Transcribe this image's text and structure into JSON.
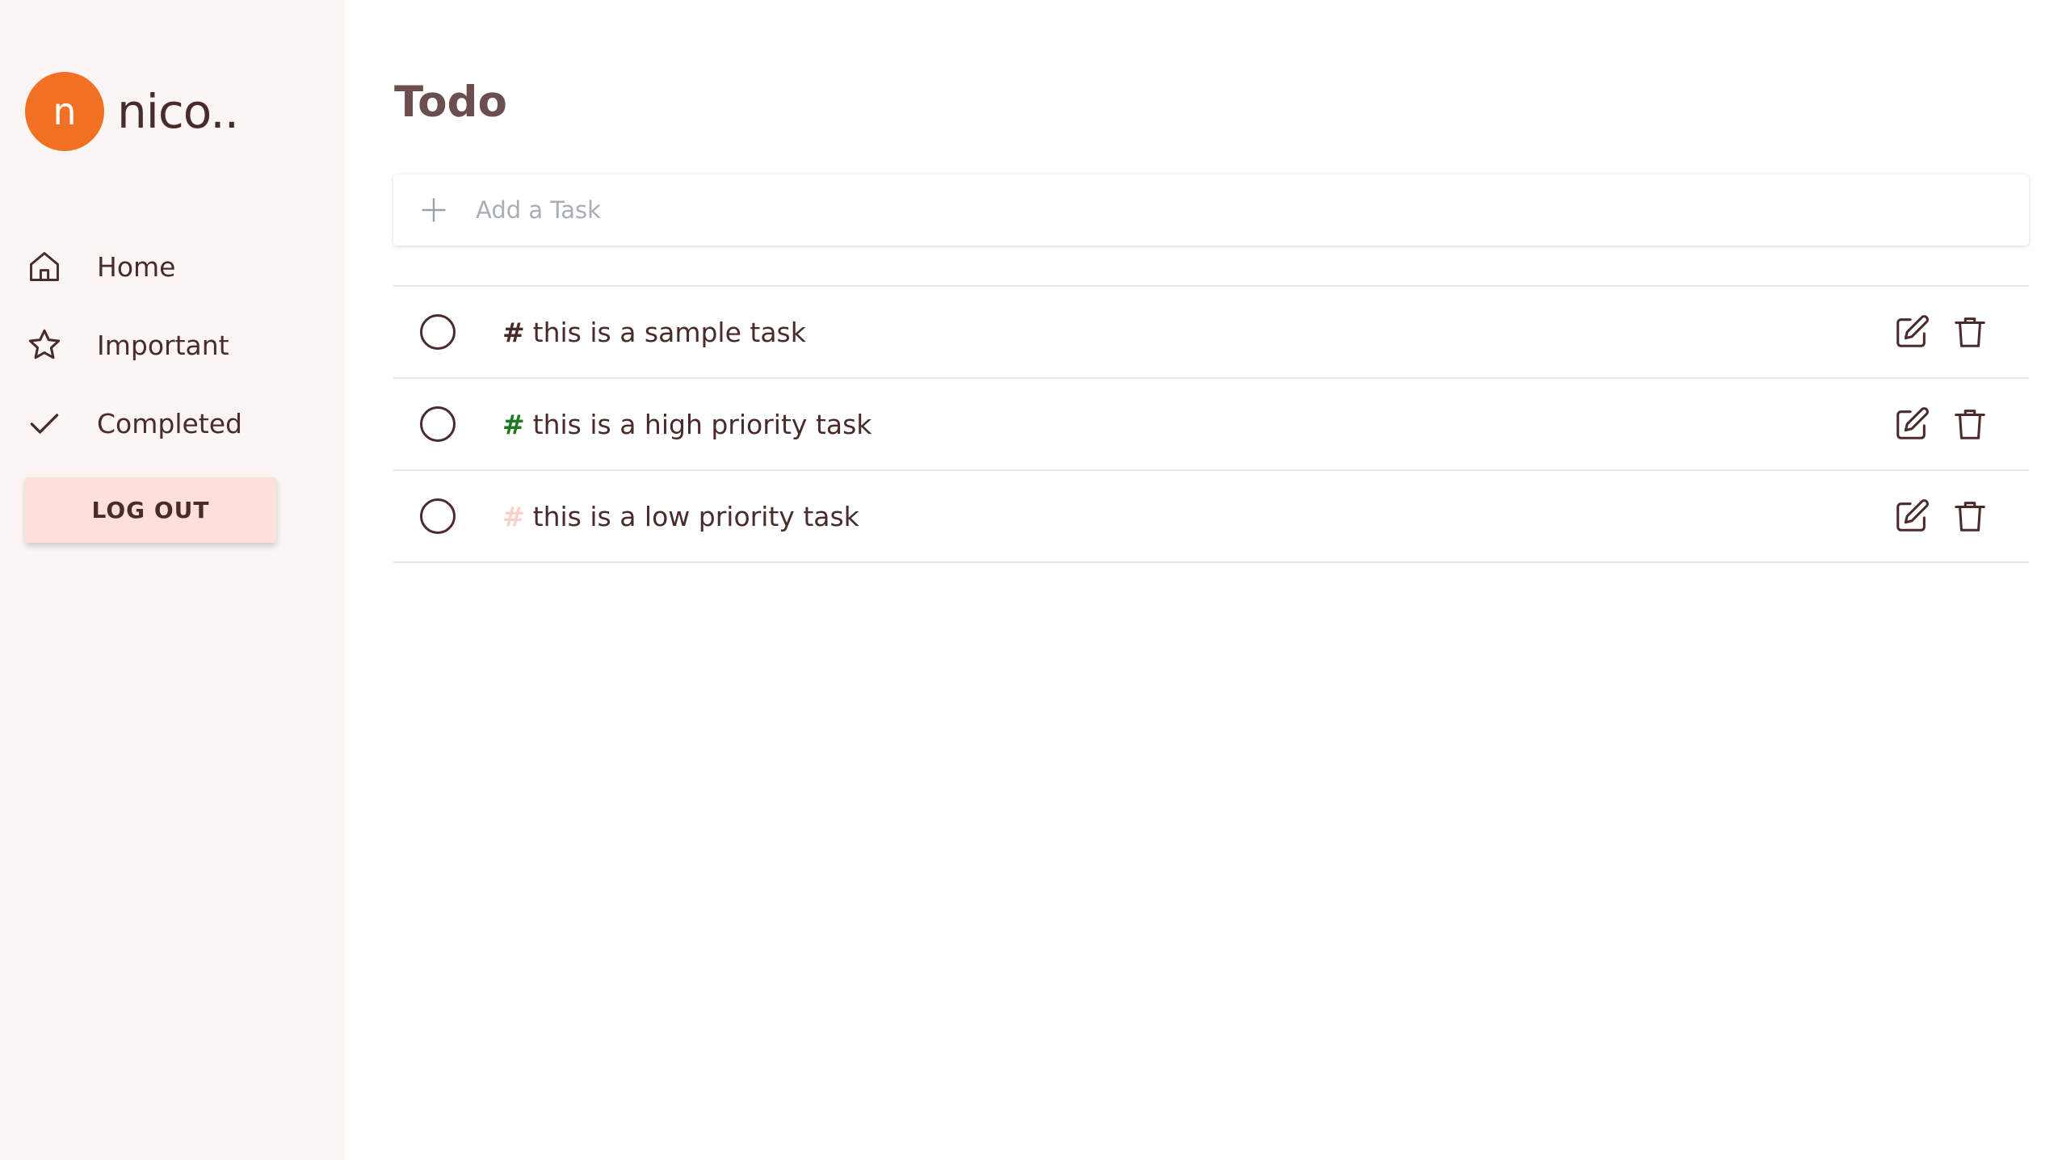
{
  "profile": {
    "initial": "n",
    "name": "nico..",
    "avatar_color": "#f07024"
  },
  "nav": {
    "items": [
      {
        "label": "Home",
        "icon": "home-icon"
      },
      {
        "label": "Important",
        "icon": "star-icon"
      },
      {
        "label": "Completed",
        "icon": "check-icon"
      }
    ],
    "logout_label": "LOG OUT"
  },
  "main": {
    "title": "Todo",
    "add_task": {
      "placeholder": "Add a Task",
      "icon": "plus-icon"
    },
    "tasks": [
      {
        "hash": "#",
        "text": "this is a sample task",
        "priority": "normal",
        "hash_color": "#4a2b2b"
      },
      {
        "hash": "#",
        "text": "this is a high priority task",
        "priority": "high",
        "hash_color": "#1e7a1e"
      },
      {
        "hash": "#",
        "text": "this is a low priority task",
        "priority": "low",
        "hash_color": "#f6d3c9"
      }
    ]
  },
  "colors": {
    "sidebar_bg": "#fbf5f4",
    "logout_bg": "#fde0d9",
    "text": "#4a2b2b",
    "title": "#6b4f4f"
  }
}
